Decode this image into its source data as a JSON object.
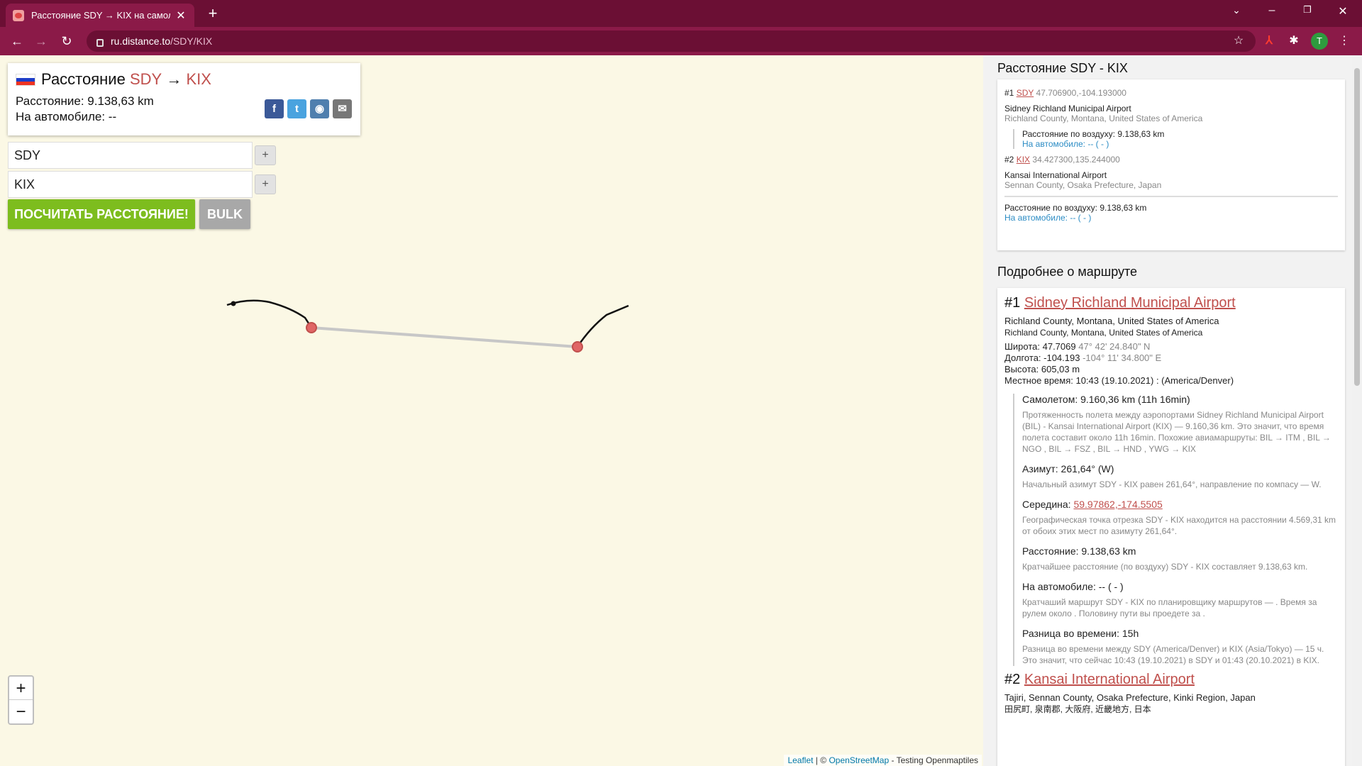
{
  "browser": {
    "tab_title": "Расстояние SDY → KIX на самол",
    "url_host": "ru.distance.to",
    "url_path": "/SDY/KIX",
    "avatar_letter": "T"
  },
  "card": {
    "title_prefix": "Расстояние",
    "from": "SDY",
    "arrow": "→",
    "to": "KIX",
    "distance_line": "Расстояние: 9.138,63 km",
    "car_line": "На автомобиле: --"
  },
  "form": {
    "from_value": "SDY",
    "to_value": "KIX",
    "plus": "+",
    "calc_button": "ПОСЧИТАТЬ РАССТОЯНИЕ!",
    "bulk_button": "BULK"
  },
  "map": {
    "zoom_in": "+",
    "zoom_out": "−",
    "attr_leaflet": "Leaflet",
    "attr_sep": " | © ",
    "attr_osm": "OpenStreetMap",
    "attr_rest": " - Testing Openmaptiles"
  },
  "sidebar": {
    "header": "Расстояние SDY - KIX",
    "p1": {
      "a_num": "#1",
      "a_code": "SDY",
      "a_coords": "47.706900,-104.193000",
      "a_name": "Sidney Richland Municipal Airport",
      "a_region": "Richland County, Montana, United States of America",
      "air": "Расстояние по воздуху: 9.138,63 km",
      "car": "На автомобиле: -- ( - )",
      "b_num": "#2",
      "b_code": "KIX",
      "b_coords": "34.427300,135.244000",
      "b_name": "Kansai International Airport",
      "b_region": "Sennan County, Osaka Prefecture, Japan",
      "total_air": "Расстояние по воздуху: 9.138,63 km",
      "total_car": "На автомобиле: -- ( - )"
    },
    "details_header": "Подробнее о маршруте",
    "p2": {
      "num1": "#1",
      "name1": "Sidney Richland Municipal Airport",
      "region1a": "Richland County, Montana, United States of America",
      "region1b": "Richland County, Montana, United States of America",
      "lat": "Широта: 47.7069",
      "lat_dms": "47° 42' 24.840\" N",
      "lon": "Долгота: -104.193",
      "lon_dms": "-104° 11' 34.800\" E",
      "alt": "Высота: 605,03 m",
      "local_time": "Местное время: 10:43 (19.10.2021) : (America/Denver)",
      "plane": "Самолетом: 9.160,36 km (11h 16min)",
      "plane_desc": "Протяженность полета между аэропортами Sidney Richland Municipal Airport (BIL) - Kansai International Airport (KIX) — 9.160,36 km. Это значит, что время полета составит около 11h 16min. Похожие авиамаршруты: BIL → ITM , BIL → NGO , BIL → FSZ , BIL → HND , YWG → KIX",
      "azimuth": "Азимут: 261,64° (W)",
      "azimuth_desc": "Начальный азимут SDY - KIX равен 261,64°, направление по компасу — W.",
      "mid_label": "Середина: ",
      "mid_link": "59.97862,-174.5505",
      "mid_desc": "Географическая точка отрезка SDY - KIX находится на расстоянии 4.569,31 km от обоих этих мест по азимуту 261,64°.",
      "dist": "Расстояние: 9.138,63 km",
      "dist_desc": "Кратчайшее расстояние (по воздуху) SDY - KIX составляет 9.138,63 km.",
      "car": "На автомобиле: -- ( - )",
      "car_desc": "Кратчаший маршрут SDY - KIX по планировщику маршрутов — . Время за рулем около . Половину пути вы проедете за .",
      "tz": "Разница во времени: 15h",
      "tz_desc": "Разница во времени между SDY (America/Denver) и KIX (Asia/Tokyo) — 15 ч. Это значит, что сейчас 10:43 (19.10.2021) в SDY и 01:43 (20.10.2021) в KIX.",
      "num2": "#2",
      "name2": "Kansai International Airport",
      "region2a": "Tajiri, Sennan County, Osaka Prefecture, Kinki Region, Japan",
      "region2b": "田尻町, 泉南郡, 大阪府, 近畿地方, 日本"
    }
  },
  "colors": {
    "chrome_dark": "#6b0f34",
    "chrome_tab": "#8b1a48",
    "accent_red": "#c0504d",
    "button_green": "#7dbd1e",
    "link_blue": "#2b8cc4"
  }
}
